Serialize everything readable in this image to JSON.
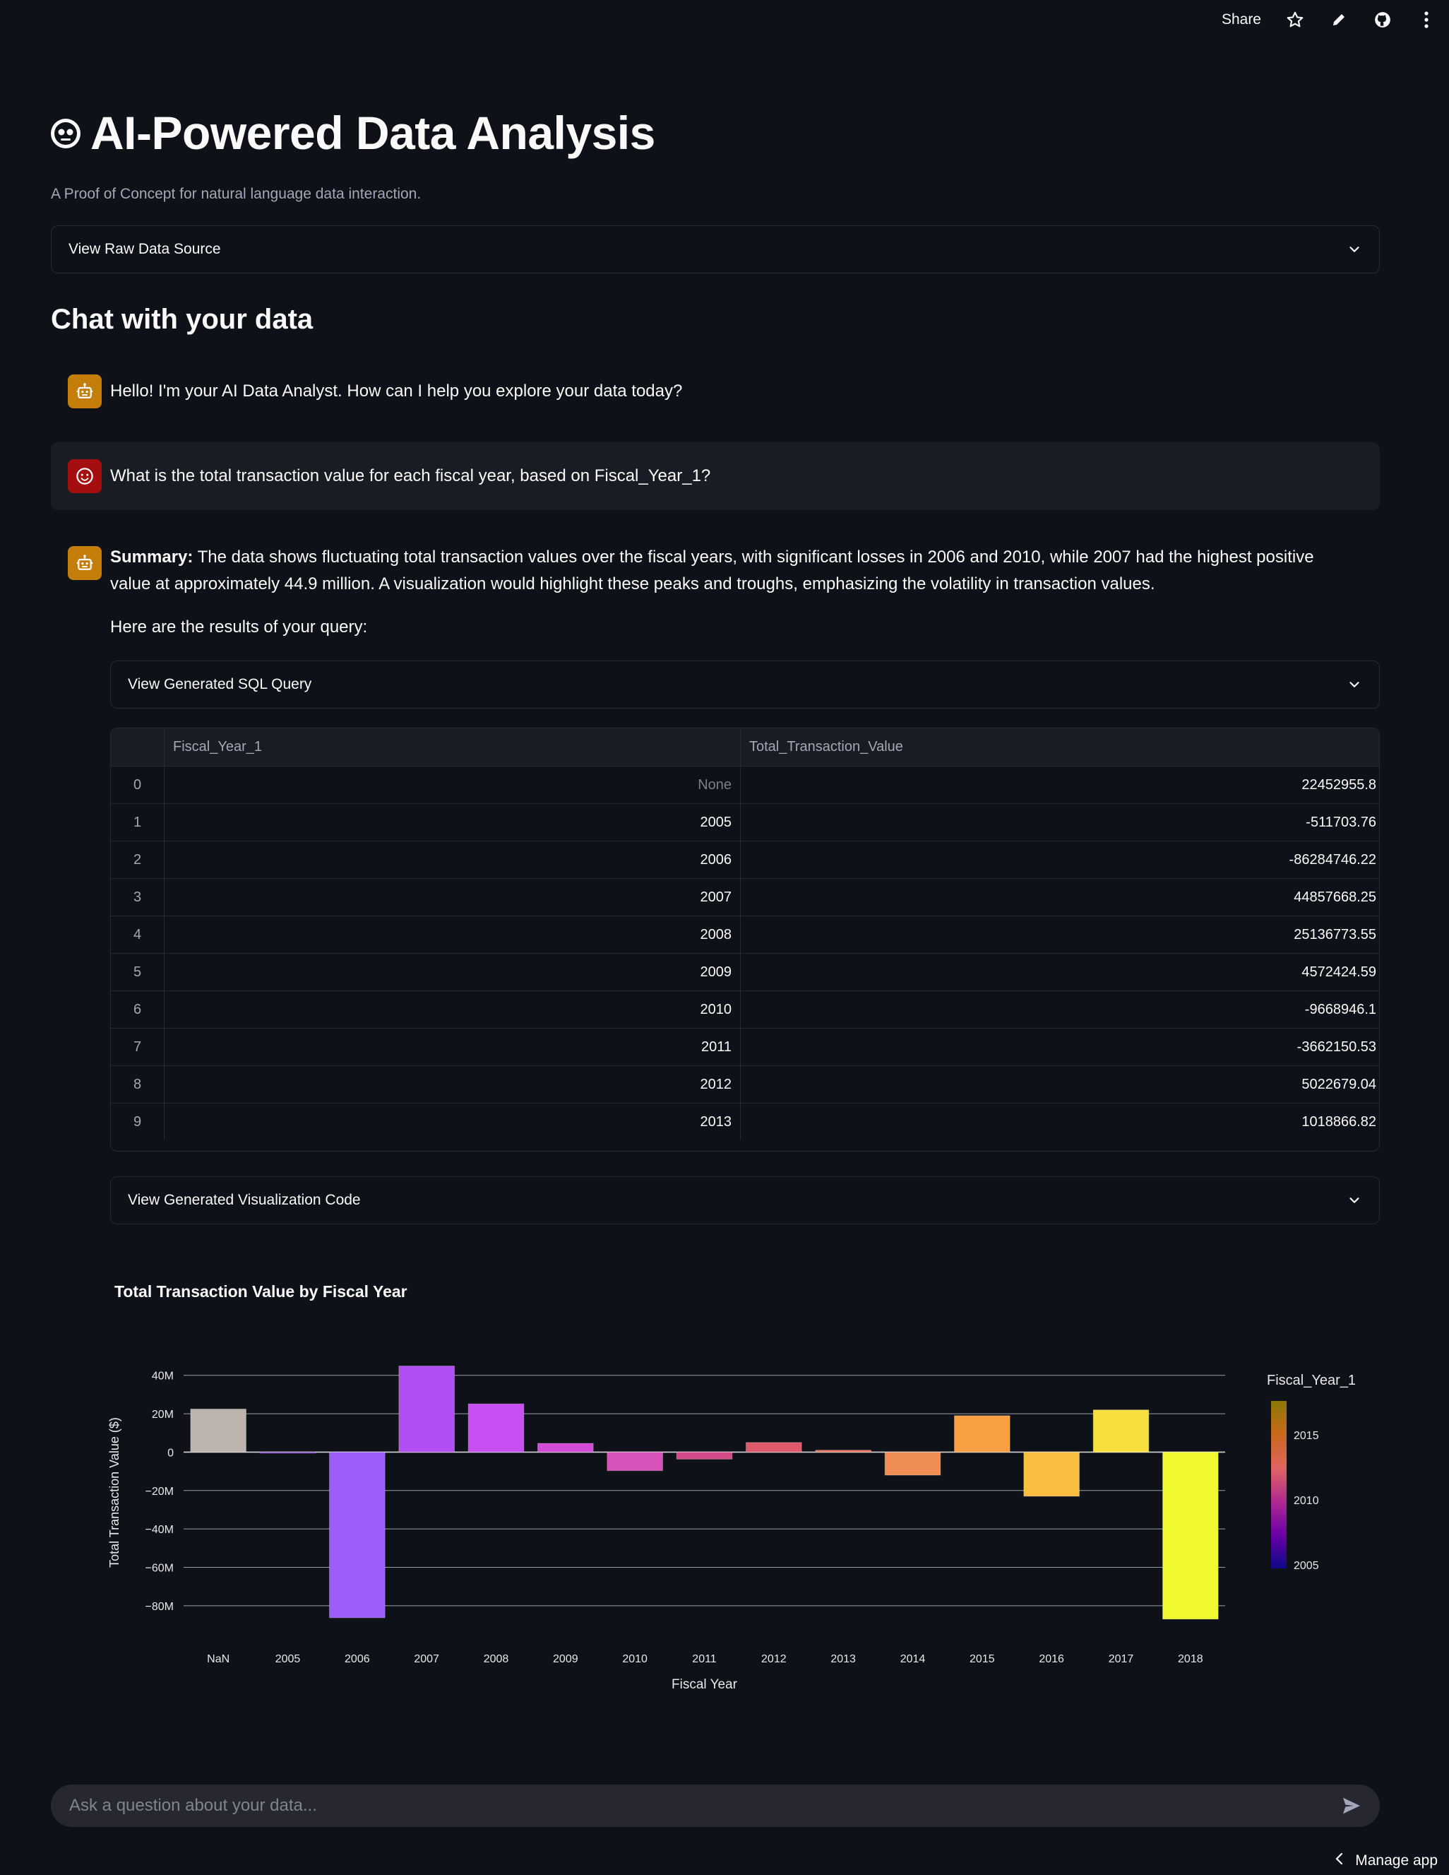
{
  "topbar": {
    "share_label": "Share",
    "icons": [
      "star-icon",
      "pencil-icon",
      "github-icon",
      "more-vertical-icon"
    ]
  },
  "header": {
    "title_emoji": "robot-face-icon",
    "title": "AI-Powered Data Analysis",
    "subtitle": "A Proof of Concept for natural language data interaction."
  },
  "raw_data_expander": {
    "label": "View Raw Data Source"
  },
  "chat_heading": "Chat with your data",
  "messages": {
    "greeting": "Hello! I'm your AI Data Analyst. How can I help you explore your data today?",
    "user_question": "What is the total transaction value for each fiscal year, based on Fiscal_Year_1?",
    "summary_label": "Summary:",
    "summary_text": " The data shows fluctuating total transaction values over the fiscal years, with significant losses in 2006 and 2010, while 2007 had the highest positive value at approximately 44.9 million. A visualization would highlight these peaks and troughs, emphasizing the volatility in transaction values.",
    "results_intro": "Here are the results of your query:"
  },
  "sql_expander": {
    "label": "View Generated SQL Query"
  },
  "viz_expander": {
    "label": "View Generated Visualization Code"
  },
  "table": {
    "columns": [
      "",
      "Fiscal_Year_1",
      "Total_Transaction_Value"
    ],
    "rows": [
      [
        "0",
        "None",
        "22452955.8"
      ],
      [
        "1",
        "2005",
        "-511703.76"
      ],
      [
        "2",
        "2006",
        "-86284746.22"
      ],
      [
        "3",
        "2007",
        "44857668.25"
      ],
      [
        "4",
        "2008",
        "25136773.55"
      ],
      [
        "5",
        "2009",
        "4572424.59"
      ],
      [
        "6",
        "2010",
        "-9668946.1"
      ],
      [
        "7",
        "2011",
        "-3662150.53"
      ],
      [
        "8",
        "2012",
        "5022679.04"
      ],
      [
        "9",
        "2013",
        "1018866.82"
      ]
    ]
  },
  "chart_data": {
    "type": "bar",
    "title": "Total Transaction Value by Fiscal Year",
    "xlabel": "Fiscal Year",
    "ylabel": "Total Transaction Value ($)",
    "categories": [
      "NaN",
      "2005",
      "2006",
      "2007",
      "2008",
      "2009",
      "2010",
      "2011",
      "2012",
      "2013",
      "2014",
      "2015",
      "2016",
      "2017",
      "2018"
    ],
    "values": [
      22452955.8,
      -511703.76,
      -86284746.22,
      44857668.25,
      25136773.55,
      4572424.59,
      -9668946.1,
      -3662150.53,
      5022679.04,
      1018866.82,
      -12000000,
      19000000,
      -23000000,
      22000000,
      -87000000
    ],
    "colors": [
      "#bdb5ad",
      "#7d2ee0",
      "#9b5cf7",
      "#b14ff5",
      "#c84ff2",
      "#d24cd9",
      "#d651b8",
      "#d54b8a",
      "#de5a6a",
      "#e8725a",
      "#f08d55",
      "#f7a043",
      "#fbbd40",
      "#f7e03d",
      "#f0f830"
    ],
    "y_ticks": [
      "40M",
      "20M",
      "0",
      "−20M",
      "−40M",
      "−60M",
      "−80M"
    ],
    "y_tick_values": [
      40000000,
      20000000,
      0,
      -20000000,
      -40000000,
      -60000000,
      -80000000
    ],
    "ylim": [
      -90000000,
      48000000
    ],
    "grid": true,
    "legend": {
      "title": "Fiscal_Year_1",
      "tick_labels": [
        "2015",
        "2010",
        "2005"
      ],
      "placement": "right",
      "colorscale": [
        "#0d0887",
        "#6a00a8",
        "#b12a90",
        "#e16462",
        "#c8691a",
        "#8b7a05"
      ]
    }
  },
  "chat_input": {
    "placeholder": "Ask a question about your data..."
  },
  "manage_app": {
    "label": "Manage app"
  }
}
